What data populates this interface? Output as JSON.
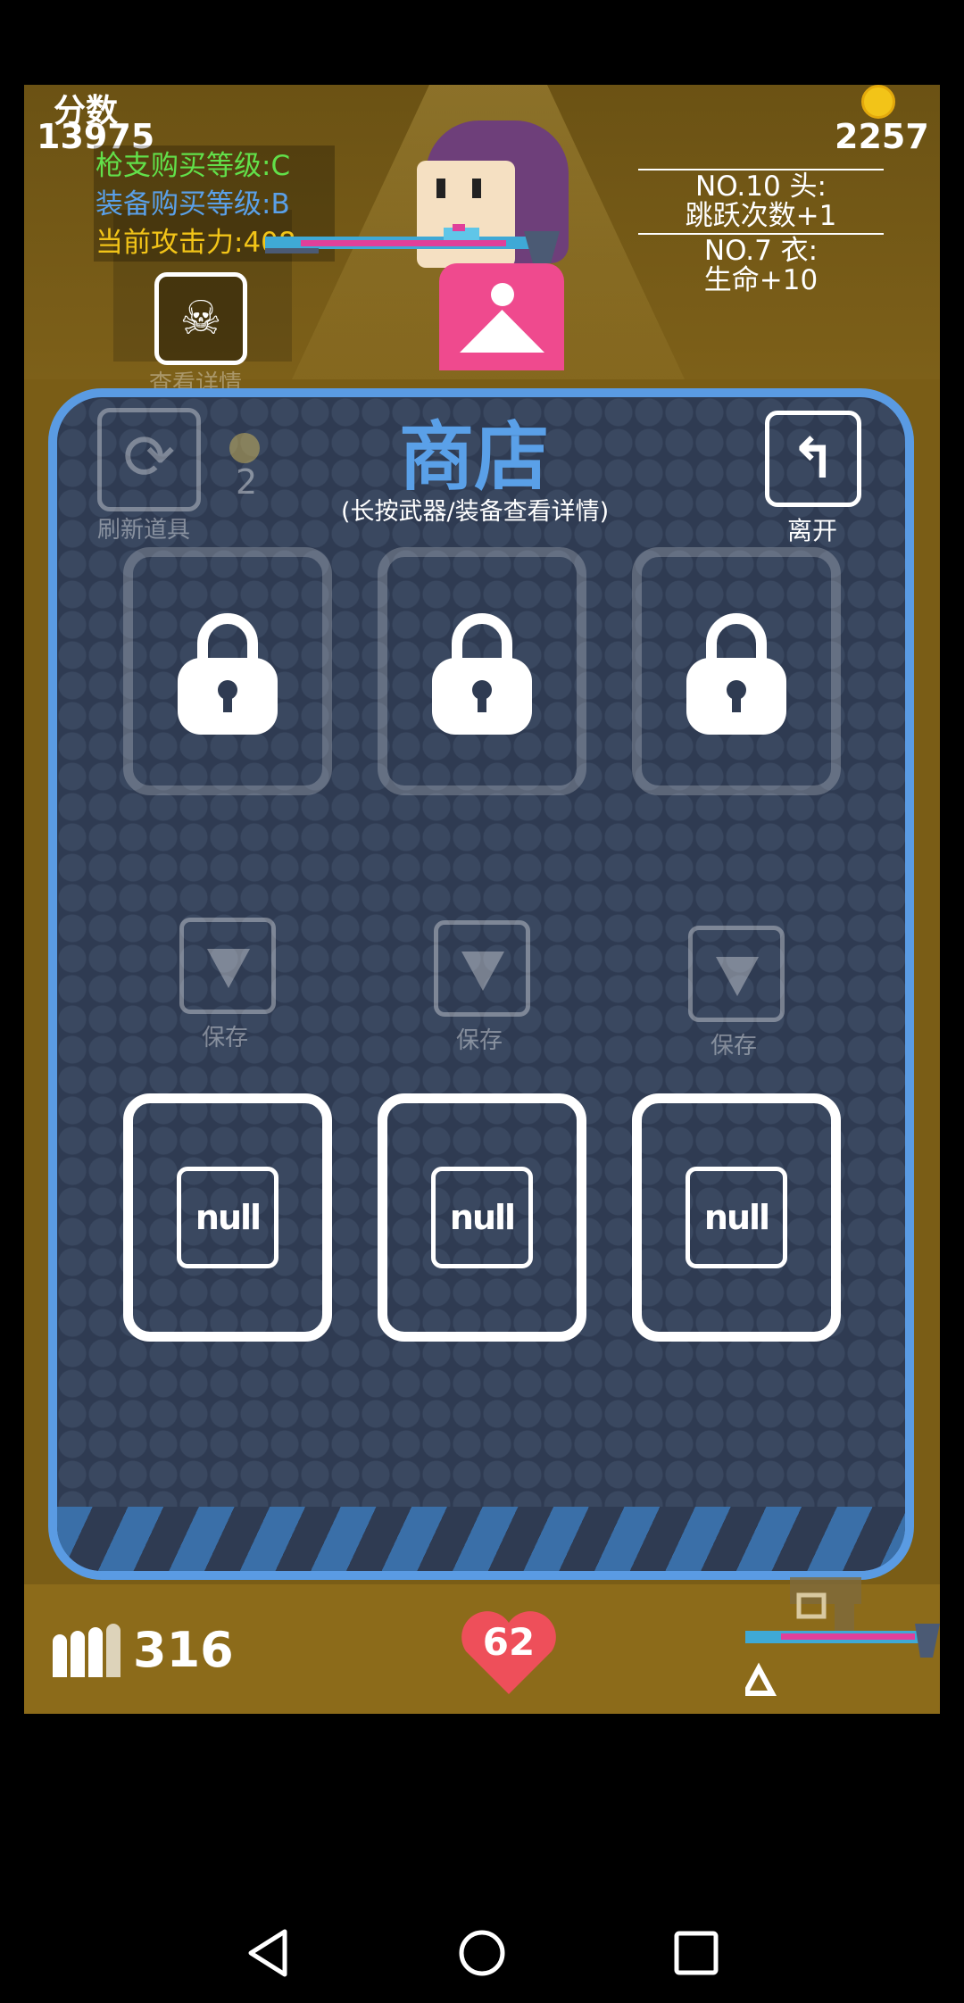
{
  "hud": {
    "score_label": "分数",
    "score_value": "13975",
    "gun_level": "枪支购买等级:C",
    "equip_level": "装备购买等级:B",
    "attack": "当前攻击力:408",
    "coins": "2257",
    "equip_head": "NO.10 头:",
    "equip_head_effect": "跳跃次数+1",
    "equip_body": "NO.7 衣:",
    "equip_body_effect": "生命+10",
    "detail_label": "查看详情",
    "colors": {
      "gun_level": "#62e04a",
      "equip_level": "#5aa0e8",
      "attack": "#f2c418"
    }
  },
  "shop": {
    "title": "商店",
    "subtitle": "(长按武器/装备查看详情)",
    "refresh_label": "刷新道具",
    "gem_count": "2",
    "leave_label": "离开",
    "locked_slots": [
      {
        "icon": "lock-icon"
      },
      {
        "icon": "lock-icon"
      },
      {
        "icon": "lock-icon"
      }
    ],
    "save_label": "保存",
    "item_slots": [
      {
        "label": "null"
      },
      {
        "label": "null"
      },
      {
        "label": "null"
      }
    ],
    "accent": "#5a9be3"
  },
  "bottom": {
    "ammo": "316",
    "health": "62"
  }
}
